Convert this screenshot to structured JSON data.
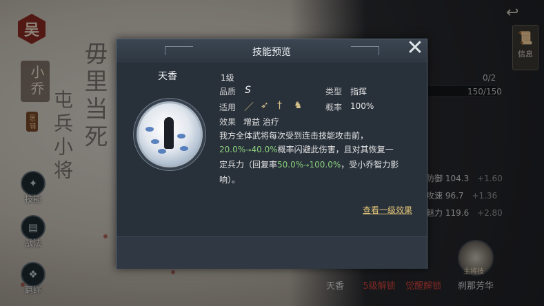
{
  "background": {
    "brush_text": "毋里当死",
    "brush_text_2": "屯兵小将"
  },
  "left_panel": {
    "faction_badge": "吴",
    "hero_name": "小乔",
    "hero_class": "医·辅",
    "buttons": [
      {
        "label": "技能",
        "icon": "skill-icon"
      },
      {
        "label": "战法",
        "icon": "scroll-icon"
      },
      {
        "label": "羁绊",
        "icon": "bond-icon"
      }
    ]
  },
  "right_panel": {
    "info_label": "信息",
    "count_text": "0/2",
    "progress_text": "150/150",
    "progress_fraction": 1.0,
    "stats": [
      {
        "name": "防御",
        "value": "104.3",
        "bonus": "+1.60"
      },
      {
        "name": "攻速",
        "value": "96.7",
        "bonus": "+1.36"
      },
      {
        "name": "魅力",
        "value": "119.6",
        "bonus": "+2.80"
      }
    ],
    "skills": [
      {
        "label": "天香",
        "color": "#e0e0e0"
      },
      {
        "label": "5级解锁",
        "color": "#d9443b"
      },
      {
        "label": "觉醒解锁",
        "color": "#d9443b"
      },
      {
        "label": "刹那芳华",
        "color": "#e0e0e0"
      }
    ],
    "skill_badge": "主将技"
  },
  "modal": {
    "title": "技能预览",
    "close_icon": "close-icon",
    "skill_name": "天香",
    "level": "1级",
    "quality_label": "品质",
    "quality_value": "S",
    "type_label": "类型",
    "type_value": "指挥",
    "apply_label": "适用",
    "apply_icons": [
      "spear-icon",
      "bow-icon",
      "sword-icon",
      "horse-icon"
    ],
    "rate_label": "概率",
    "rate_value": "100%",
    "effect_label": "效果",
    "effect_value": "增益 治疗",
    "desc_1": "我方全体武将每次受到连击技能攻击前，",
    "desc_2_val1": "20.0%",
    "desc_2_arrow": "→",
    "desc_2_val2": "40.0%",
    "desc_2_rest": "概率闪避此伤害，且对其恢复一",
    "desc_3_pre": "定兵力（回复率",
    "desc_3_val1": "50.0%",
    "desc_3_arrow": "→",
    "desc_3_val2": "100.0%",
    "desc_3_post": "，受小乔智力影",
    "desc_4": "响）。",
    "link_text": "查看一级效果"
  }
}
